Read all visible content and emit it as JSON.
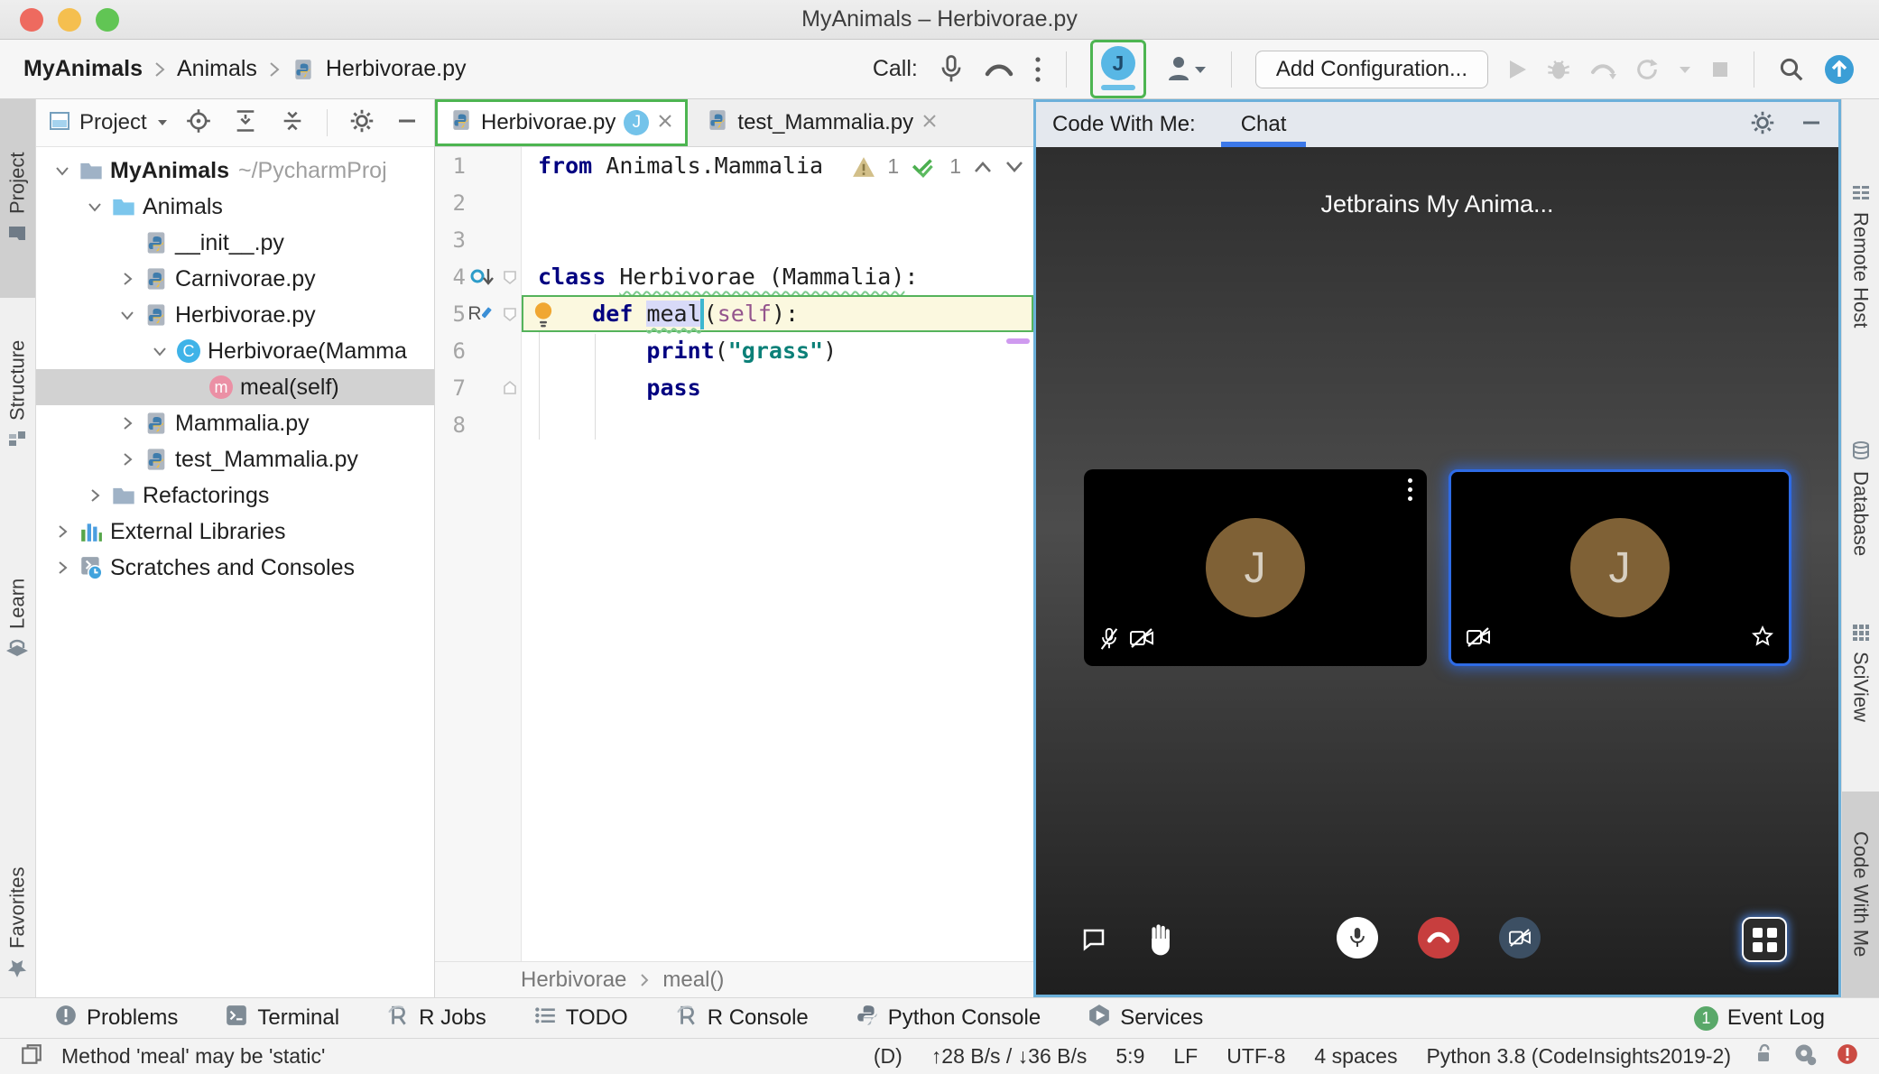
{
  "window": {
    "title": "MyAnimals – Herbivorae.py"
  },
  "toolbar": {
    "breadcrumbs": [
      "MyAnimals",
      "Animals",
      "Herbivorae.py"
    ],
    "call_label": "Call:",
    "avatar_letter": "J",
    "add_configuration": "Add Configuration..."
  },
  "left_stripe": {
    "items": [
      {
        "label": "Project",
        "icon": "folder-tool",
        "active": true
      },
      {
        "label": "Structure",
        "icon": "structure"
      },
      {
        "label": "Learn",
        "icon": "learn"
      },
      {
        "label": "Favorites",
        "icon": "star"
      }
    ]
  },
  "right_stripe": {
    "items": [
      {
        "label": "Remote Host",
        "icon": "remote-host"
      },
      {
        "label": "Database",
        "icon": "database"
      },
      {
        "label": "SciView",
        "icon": "sciview"
      },
      {
        "label": "Code With Me",
        "icon": "none",
        "active": true
      }
    ]
  },
  "project_panel": {
    "title": "Project",
    "tree": [
      {
        "label": "MyAnimals",
        "hint": "~/PycharmProj",
        "icon": "folder",
        "chevron": "open",
        "indent": 0,
        "bold": true
      },
      {
        "label": "Animals",
        "icon": "folder-blue",
        "chevron": "open",
        "indent": 1
      },
      {
        "label": "__init__.py",
        "icon": "py",
        "chevron": "none",
        "indent": 2
      },
      {
        "label": "Carnivorae.py",
        "icon": "py",
        "chevron": "closed",
        "indent": 2
      },
      {
        "label": "Herbivorae.py",
        "icon": "py",
        "chevron": "open",
        "indent": 2
      },
      {
        "label": "Herbivorae(Mamma",
        "icon": "class",
        "icon_letter": "C",
        "chevron": "open",
        "indent": 3
      },
      {
        "label": "meal(self)",
        "icon": "method",
        "icon_letter": "m",
        "chevron": "none",
        "indent": 4,
        "selected": true
      },
      {
        "label": "Mammalia.py",
        "icon": "py",
        "chevron": "closed",
        "indent": 2
      },
      {
        "label": "test_Mammalia.py",
        "icon": "py",
        "chevron": "closed",
        "indent": 2
      },
      {
        "label": "Refactorings",
        "icon": "folder",
        "chevron": "closed",
        "indent": 1
      },
      {
        "label": "External Libraries",
        "icon": "libs",
        "chevron": "closed",
        "indent": 0
      },
      {
        "label": "Scratches and Consoles",
        "icon": "scratch",
        "chevron": "closed",
        "indent": 0
      }
    ]
  },
  "editor": {
    "tabs": [
      {
        "label": "Herbivorae.py",
        "badge": "J",
        "active": true
      },
      {
        "label": "test_Mammalia.py"
      }
    ],
    "inspections": {
      "warning_count": "1",
      "ok_count": "1"
    },
    "gutter_letter": "R",
    "lines": [
      {
        "num": "1",
        "tokens": [
          [
            "kw",
            "from"
          ],
          [
            "pl",
            " Animals.Mammalia"
          ]
        ]
      },
      {
        "num": "2",
        "tokens": []
      },
      {
        "num": "3",
        "tokens": []
      },
      {
        "num": "4",
        "gutter": "override",
        "fold": "open",
        "tokens": [
          [
            "kw",
            "class"
          ],
          [
            "pl",
            " "
          ],
          [
            "wavy",
            "Herbivorae (Mammalia)"
          ],
          [
            "pl",
            ":"
          ]
        ]
      },
      {
        "num": "5",
        "gutter": "edit",
        "fold": "open",
        "highlight": true,
        "bulb": true,
        "tokens": [
          [
            "pl",
            "    "
          ],
          [
            "kw",
            "def"
          ],
          [
            "pl",
            " "
          ],
          [
            "sel",
            "meal"
          ],
          [
            "caret",
            ""
          ],
          [
            "pl",
            "("
          ],
          [
            "param",
            "self"
          ],
          [
            "pl",
            "):"
          ]
        ]
      },
      {
        "num": "6",
        "tokens": [
          [
            "pl",
            "        "
          ],
          [
            "kw",
            "print"
          ],
          [
            "pl",
            "("
          ],
          [
            "str",
            "\"grass\""
          ],
          [
            "pl",
            ")"
          ]
        ]
      },
      {
        "num": "7",
        "fold": "close",
        "tokens": [
          [
            "pl",
            "        "
          ],
          [
            "kw",
            "pass"
          ]
        ]
      },
      {
        "num": "8",
        "tokens": []
      }
    ],
    "breadcrumbs": [
      "Herbivorae",
      "meal()"
    ]
  },
  "cwm": {
    "header_label": "Code With Me:",
    "tab_label": "Chat",
    "session_title": "Jetbrains My Anima...",
    "tiles": [
      {
        "letter": "J",
        "mic_off": true,
        "camera_off": true,
        "menu": true
      },
      {
        "letter": "J",
        "camera_off": true,
        "star": true,
        "active": true
      }
    ]
  },
  "bottom_bar": {
    "tabs": [
      {
        "label": "Problems",
        "icon": "problems"
      },
      {
        "label": "Terminal",
        "icon": "terminal"
      },
      {
        "label": "R Jobs",
        "icon": "r"
      },
      {
        "label": "TODO",
        "icon": "todo"
      },
      {
        "label": "R Console",
        "icon": "r"
      },
      {
        "label": "Python Console",
        "icon": "py-gray"
      },
      {
        "label": "Services",
        "icon": "services"
      }
    ],
    "event_log": {
      "label": "Event Log",
      "badge": "1"
    }
  },
  "status_bar": {
    "message": "Method 'meal' may be 'static'",
    "items": [
      "(D)",
      "↑28 B/s / ↓36 B/s",
      "5:9",
      "LF",
      "UTF-8",
      "4 spaces",
      "Python 3.8 (CodeInsights2019-2)"
    ]
  }
}
